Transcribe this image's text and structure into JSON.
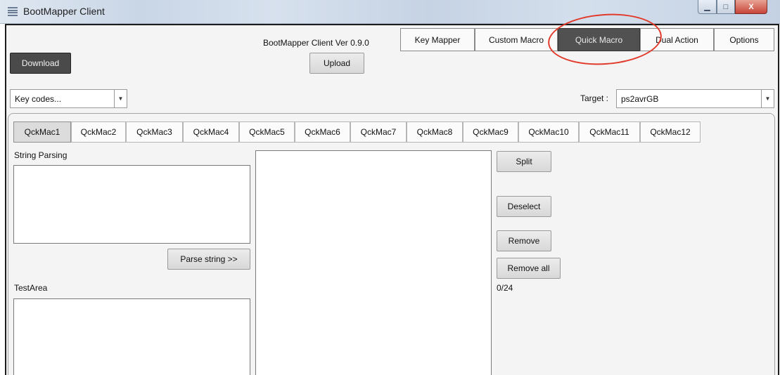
{
  "window": {
    "title": "BootMapper Client",
    "version": "BootMapper Client Ver 0.9.0",
    "controls": {
      "minimize": "▁",
      "maximize": "□",
      "close": "X"
    }
  },
  "tabs": [
    "Key Mapper",
    "Custom Macro",
    "Quick Macro",
    "Dual Action",
    "Options"
  ],
  "active_tab": "Quick Macro",
  "toolbar": {
    "download": "Download",
    "upload": "Upload"
  },
  "key_codes": {
    "value": "Key codes..."
  },
  "target": {
    "label": "Target :",
    "value": "ps2avrGB"
  },
  "macro_tabs": [
    "QckMac1",
    "QckMac2",
    "QckMac3",
    "QckMac4",
    "QckMac5",
    "QckMac6",
    "QckMac7",
    "QckMac8",
    "QckMac9",
    "QckMac10",
    "QckMac11",
    "QckMac12"
  ],
  "active_macro_tab": "QckMac1",
  "string_parsing": {
    "label": "String Parsing",
    "parse_button": "Parse string >>"
  },
  "test_area": {
    "label": "TestArea"
  },
  "actions": {
    "split": "Split",
    "deselect": "Deselect",
    "remove": "Remove",
    "remove_all": "Remove all"
  },
  "counter": "0/24",
  "accent_colors": {
    "active_tab_bg": "#515151",
    "annotation_circle": "#e23a2a"
  },
  "icons": {
    "app": "app-menu-icon",
    "dropdown": "chevron-down-icon"
  }
}
